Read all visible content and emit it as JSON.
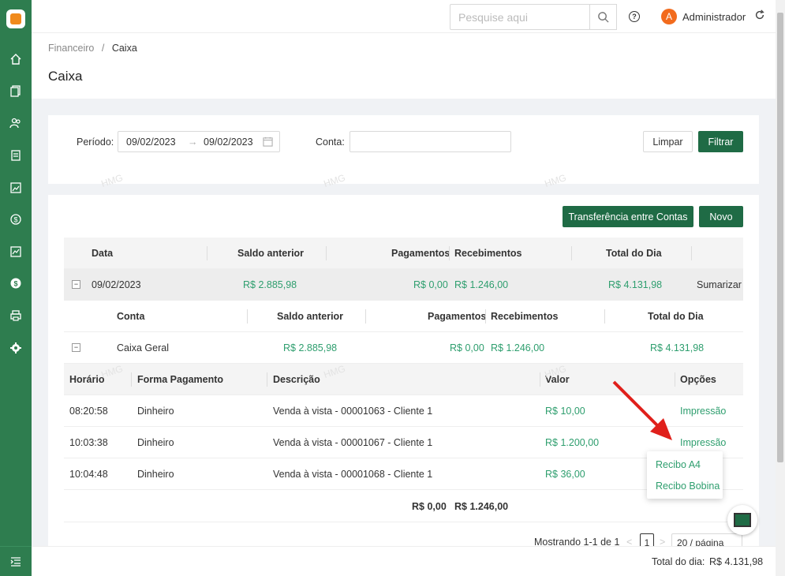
{
  "header": {
    "search_placeholder": "Pesquise aqui",
    "avatar_initial": "A",
    "username": "Administrador"
  },
  "breadcrumb": {
    "parent": "Financeiro",
    "separator": "/",
    "current": "Caixa"
  },
  "page_title": "Caixa",
  "filters": {
    "period_label": "Período",
    "start_date": "09/02/2023",
    "end_date": "09/02/2023",
    "account_label": "Conta",
    "account_value": "",
    "clear_label": "Limpar",
    "filter_label": "Filtrar"
  },
  "actions": {
    "transfer_label": "Transferência entre Contas",
    "new_label": "Novo"
  },
  "day_table": {
    "headers": [
      "Data",
      "Saldo anterior",
      "Pagamentos",
      "Recebimentos",
      "Total do Dia"
    ],
    "row": {
      "date": "09/02/2023",
      "previous_balance": "R$ 2.885,98",
      "payments": "R$ 0,00",
      "receipts": "R$ 1.246,00",
      "total": "R$ 4.131,98",
      "action": "Sumarizar"
    }
  },
  "account_table": {
    "headers": [
      "Conta",
      "Saldo anterior",
      "Pagamentos",
      "Recebimentos",
      "Total do Dia"
    ],
    "row": {
      "account": "Caixa Geral",
      "previous_balance": "R$ 2.885,98",
      "payments": "R$ 0,00",
      "receipts": "R$ 1.246,00",
      "total": "R$ 4.131,98"
    }
  },
  "transactions": {
    "headers": [
      "Horário",
      "Forma Pagamento",
      "Descrição",
      "Valor",
      "Opções"
    ],
    "rows": [
      {
        "time": "08:20:58",
        "method": "Dinheiro",
        "description": "Venda à vista - 00001063 - Cliente 1",
        "value": "R$ 10,00",
        "option": "Impressão"
      },
      {
        "time": "10:03:38",
        "method": "Dinheiro",
        "description": "Venda à vista - 00001067 - Cliente 1",
        "value": "R$ 1.200,00",
        "option": "Impressão"
      },
      {
        "time": "10:04:48",
        "method": "Dinheiro",
        "description": "Venda à vista - 00001068 - Cliente 1",
        "value": "R$ 36,00",
        "option": ""
      }
    ],
    "totals": {
      "payments": "R$ 0,00",
      "receipts": "R$ 1.246,00"
    }
  },
  "print_menu": {
    "items": [
      "Recibo A4",
      "Recibo Bobina"
    ]
  },
  "pagination": {
    "summary": "Mostrando 1-1 de 1",
    "prev": "<",
    "page": "1",
    "next": ">",
    "page_size": "20 / página"
  },
  "footer": {
    "total_label": "Total do dia:",
    "total_value": "R$ 4.131,98"
  },
  "watermark": "HMG",
  "colors": {
    "sidebar": "#2e7d4f",
    "primary": "#1f6b45",
    "money_green": "#2e9e6e",
    "avatar": "#f26b1d"
  }
}
